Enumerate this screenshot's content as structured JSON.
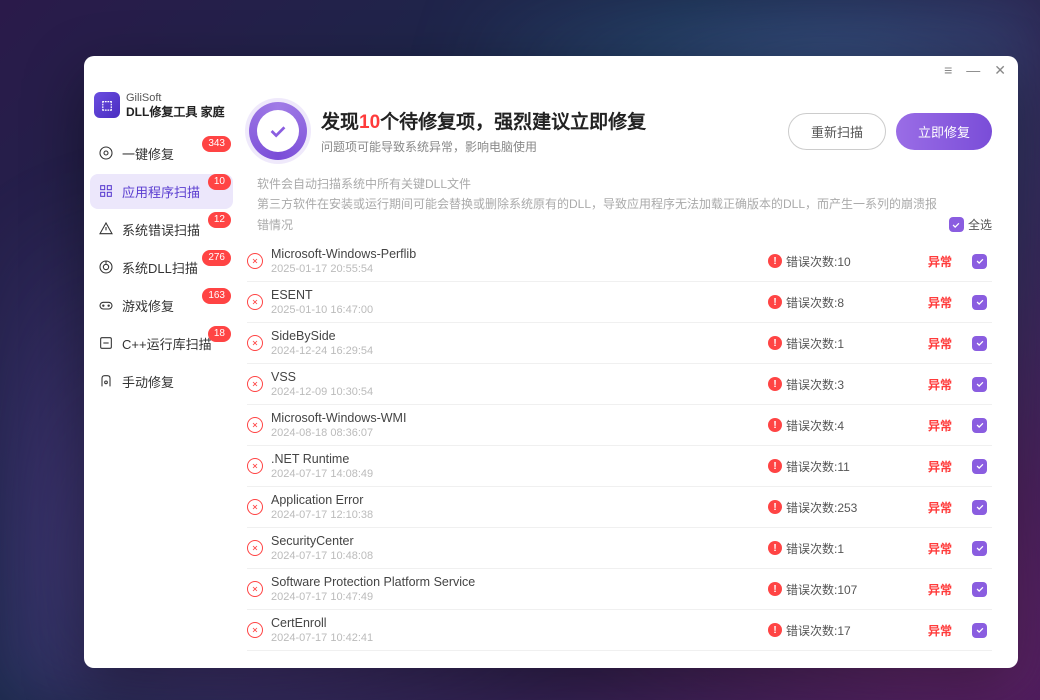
{
  "brand": {
    "company": "GiliSoft",
    "product": "DLL修复工具 家庭"
  },
  "sidebar": [
    {
      "id": "oneclick",
      "label": "一键修复",
      "badge": "343"
    },
    {
      "id": "appscan",
      "label": "应用程序扫描",
      "badge": "10",
      "active": true
    },
    {
      "id": "syserr",
      "label": "系统错误扫描",
      "badge": "12"
    },
    {
      "id": "sysdll",
      "label": "系统DLL扫描",
      "badge": "276"
    },
    {
      "id": "game",
      "label": "游戏修复",
      "badge": "163"
    },
    {
      "id": "cpp",
      "label": "C++运行库扫描",
      "badge": "18"
    },
    {
      "id": "manual",
      "label": "手动修复",
      "badge": null
    }
  ],
  "header": {
    "prefix": "发现",
    "count": "10",
    "suffix": "个待修复项，强烈建议立即修复",
    "subtitle": "问题项可能导致系统异常，影响电脑使用",
    "rescan": "重新扫描",
    "fixnow": "立即修复"
  },
  "desc": {
    "line1": "软件会自动扫描系统中所有关键DLL文件",
    "line2": "第三方软件在安装或运行期间可能会替换或删除系统原有的DLL，导致应用程序无法加载正确版本的DLL，而产生一系列的崩溃报错情况"
  },
  "select_all_label": "全选",
  "error_prefix": "错误次数:",
  "status_abnormal": "异常",
  "rows": [
    {
      "name": "Microsoft-Windows-Perflib",
      "time": "2025-01-17 20:55:54",
      "count": "10"
    },
    {
      "name": "ESENT",
      "time": "2025-01-10 16:47:00",
      "count": "8"
    },
    {
      "name": "SideBySide",
      "time": "2024-12-24 16:29:54",
      "count": "1"
    },
    {
      "name": "VSS",
      "time": "2024-12-09 10:30:54",
      "count": "3"
    },
    {
      "name": "Microsoft-Windows-WMI",
      "time": "2024-08-18 08:36:07",
      "count": "4"
    },
    {
      "name": ".NET Runtime",
      "time": "2024-07-17 14:08:49",
      "count": "11"
    },
    {
      "name": "Application Error",
      "time": "2024-07-17 12:10:38",
      "count": "253"
    },
    {
      "name": "SecurityCenter",
      "time": "2024-07-17 10:48:08",
      "count": "1"
    },
    {
      "name": "Software Protection Platform Service",
      "time": "2024-07-17 10:47:49",
      "count": "107"
    },
    {
      "name": "CertEnroll",
      "time": "2024-07-17 10:42:41",
      "count": "17"
    }
  ]
}
